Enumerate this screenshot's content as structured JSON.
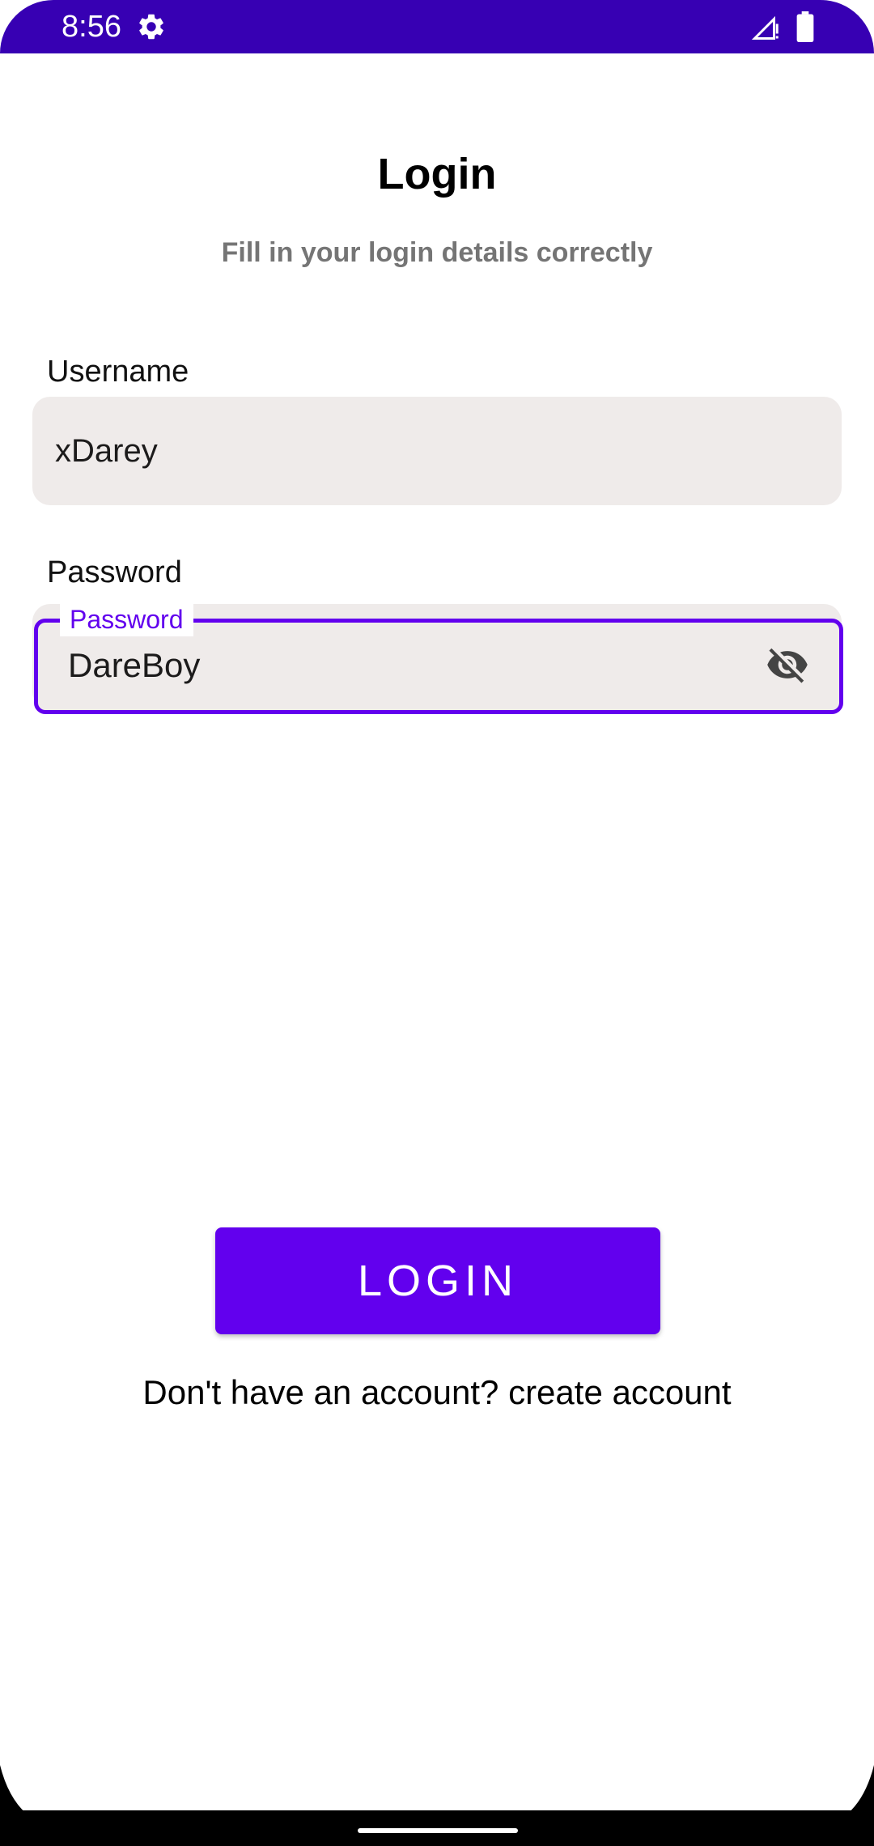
{
  "status_bar": {
    "time": "8:56",
    "icons": [
      "gear-icon",
      "signal-icon",
      "battery-icon"
    ],
    "color": "#3700b3"
  },
  "screen": {
    "title": "Login",
    "subtitle": "Fill in your login details correctly"
  },
  "username": {
    "label": "Username",
    "value": "xDarey"
  },
  "password": {
    "label": "Password",
    "floating_label": "Password",
    "value": "DareBoy",
    "toggle_icon": "visibility-off-icon"
  },
  "actions": {
    "login_label": "LOGIN",
    "signup_text": "Don't have an account? create account"
  },
  "colors": {
    "accent": "#6200ee",
    "field_background": "#efebea",
    "subtitle": "#757575"
  }
}
